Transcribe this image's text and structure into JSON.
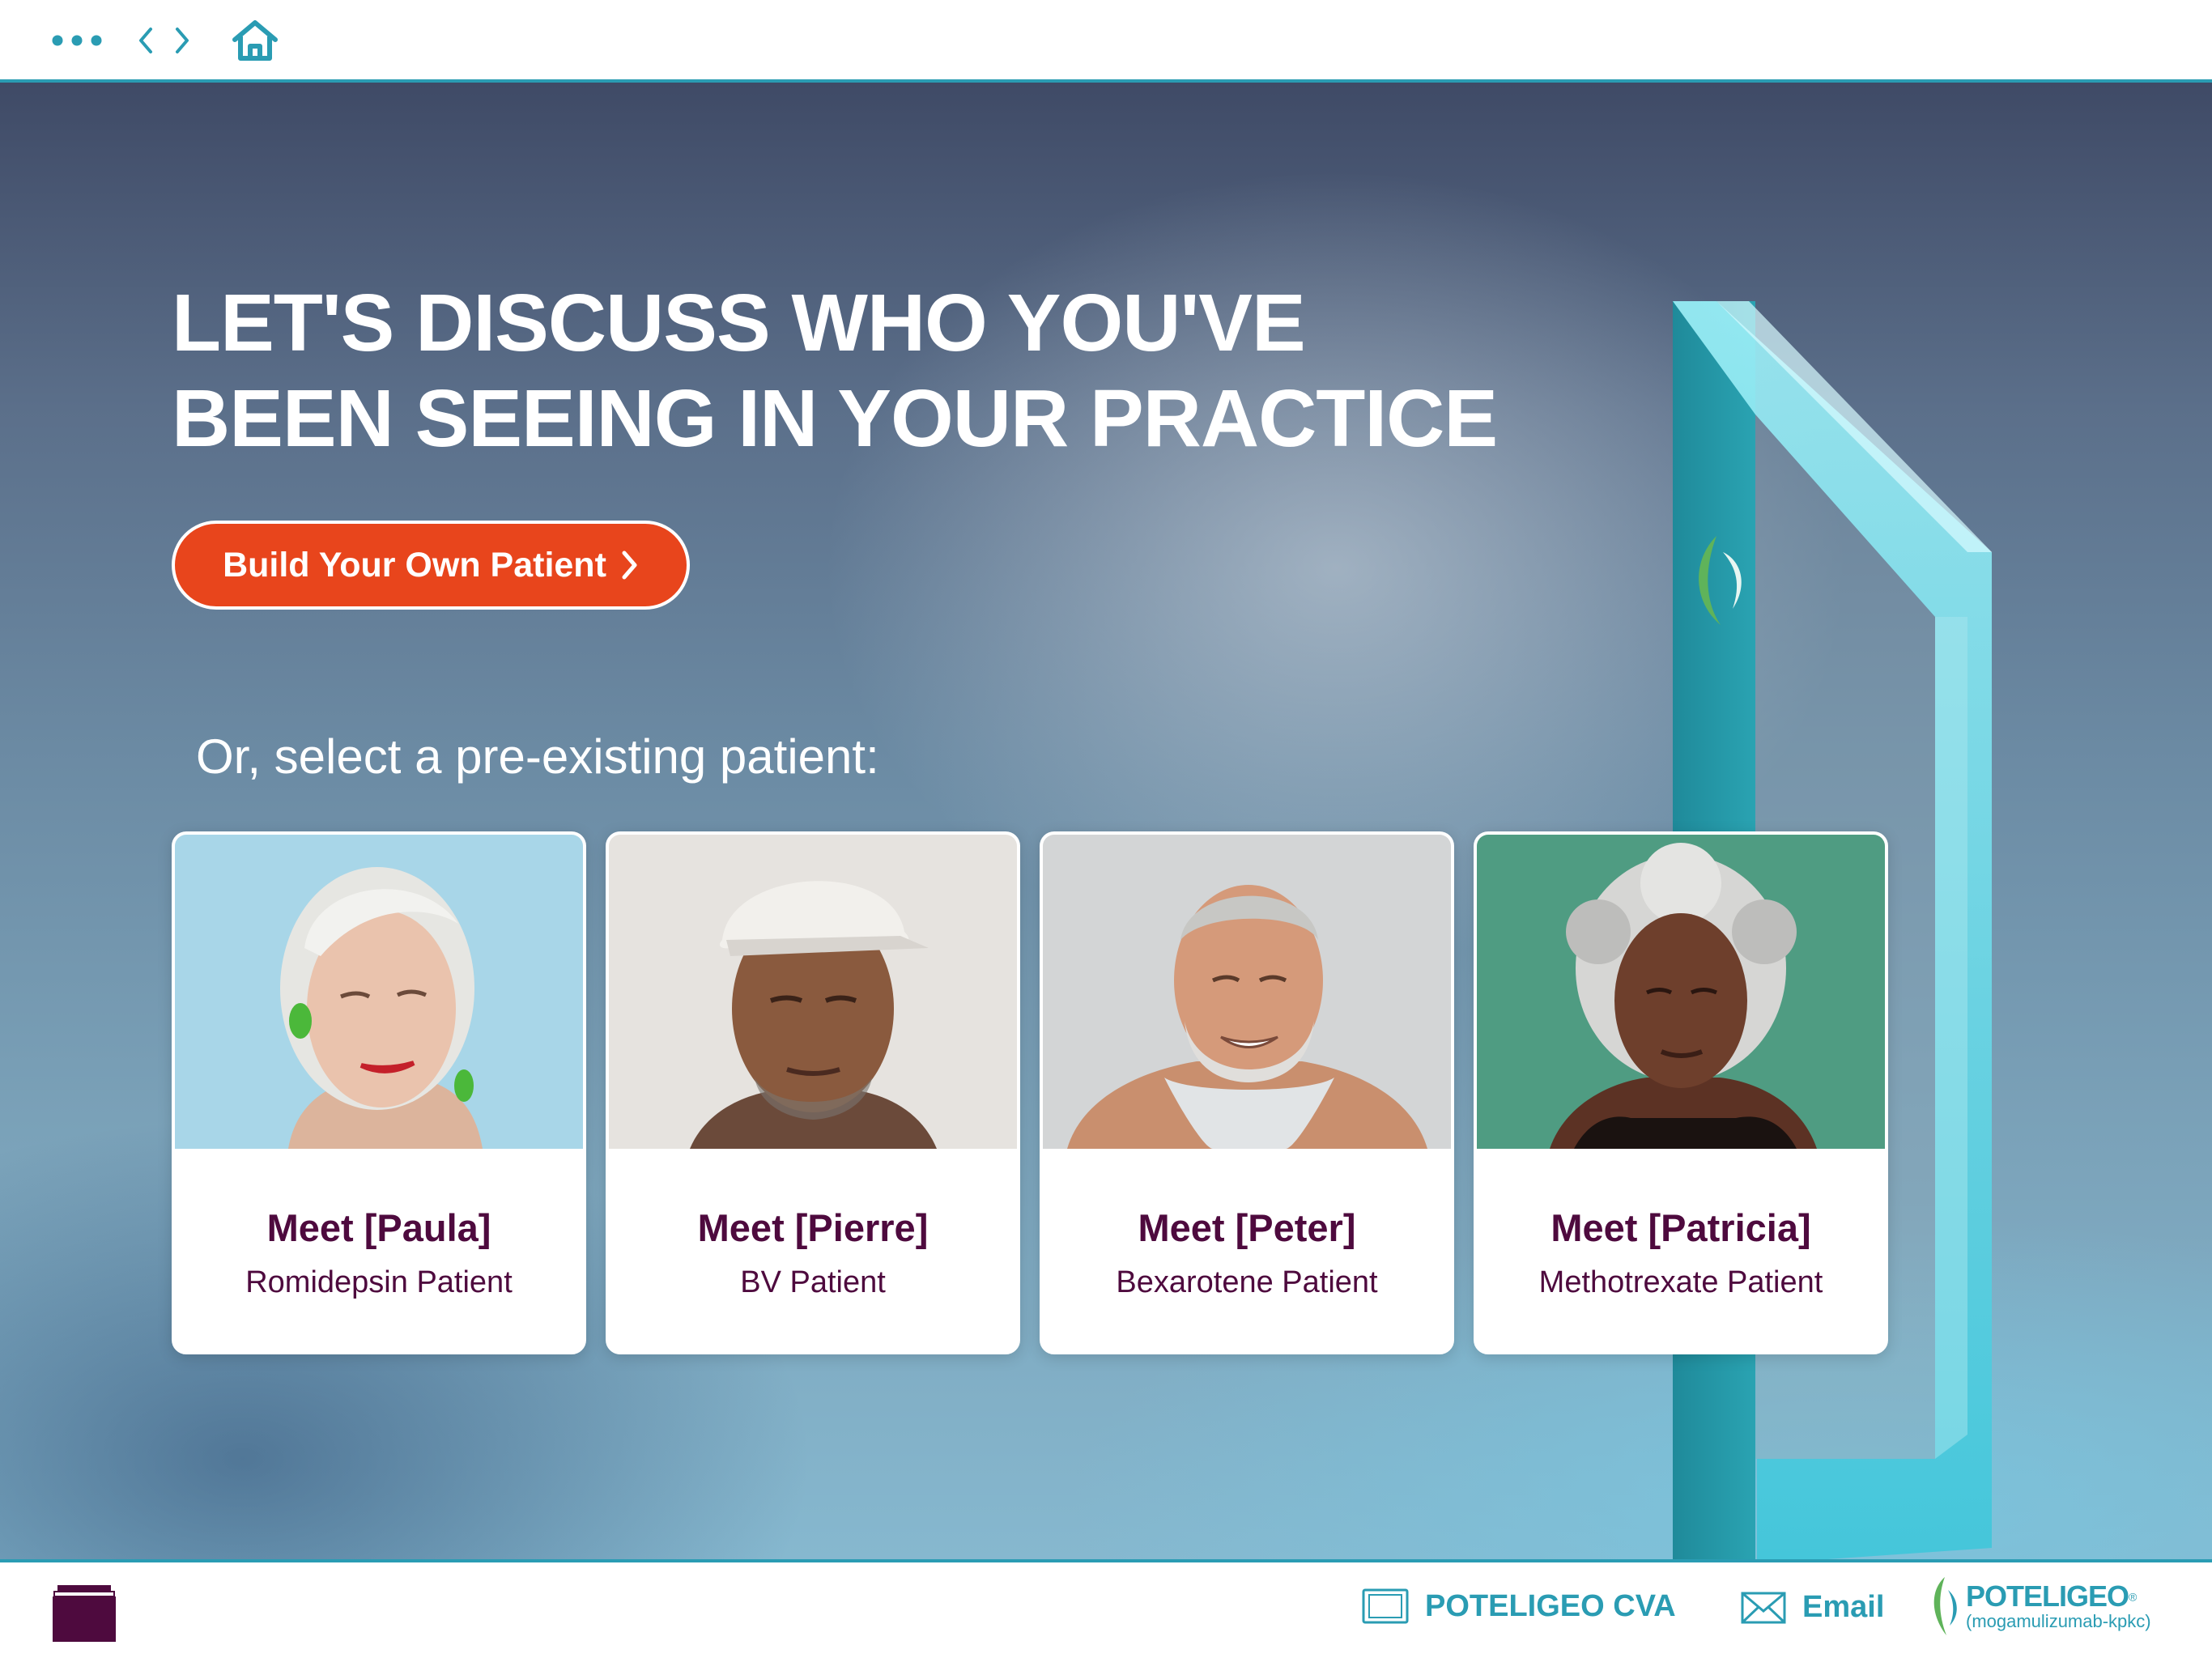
{
  "topbar": {
    "icons": [
      "more-icon",
      "chevron-left-icon",
      "chevron-right-icon",
      "home-icon"
    ]
  },
  "hero": {
    "headline": "LET'S DISCUSS WHO YOU'VE BEEN SEEING IN YOUR PRACTICE",
    "build_button_label": "Build Your Own Patient",
    "subhead": "Or, select a pre-existing patient:"
  },
  "patients": [
    {
      "name": "Meet [Paula]",
      "type": "Romidepsin Patient",
      "photo": "older-woman-portrait",
      "bg_color": "#a8d6e8"
    },
    {
      "name": "Meet [Pierre]",
      "type": "BV Patient",
      "photo": "man-with-cap-portrait",
      "bg_color": "#e6e3df"
    },
    {
      "name": "Meet [Peter]",
      "type": "Bexarotene Patient",
      "photo": "bearded-man-portrait",
      "bg_color": "#d3d5d6"
    },
    {
      "name": "Meet [Patricia]",
      "type": "Methotrexate Patient",
      "photo": "older-woman-portrait",
      "bg_color": "#4f9c82"
    }
  ],
  "footer": {
    "cva_label": "POTELIGEO CVA",
    "email_label": "Email",
    "logo_word": "POTELIGEO",
    "logo_mark": "®",
    "logo_sub": "(mogamulizumab-kpkc)"
  },
  "colors": {
    "accent": "#2a9cb3",
    "cta": "#e8451c",
    "card_text": "#4e0a3e",
    "footer_square": "#4e0a3e"
  }
}
